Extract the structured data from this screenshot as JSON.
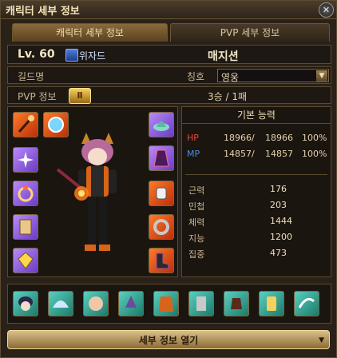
{
  "window": {
    "title": "캐릭터 세부 정보",
    "close_icon": "close-icon"
  },
  "tabs": [
    {
      "label": "캐릭터 세부 정보",
      "active": true
    },
    {
      "label": "PVP 세부 정보",
      "active": false
    }
  ],
  "info": {
    "level": "Lv. 60",
    "class_name": "위자드",
    "char_name": "매지션",
    "guild_label": "길드명",
    "guild_value": "",
    "title_label": "칭호",
    "title_value": "영웅",
    "pvp_label": "PVP 정보",
    "pvp_record": "3승  /  1패"
  },
  "stats": {
    "header": "기본 능력",
    "hp": {
      "label": "HP",
      "current": "18966/",
      "max": "18966",
      "pct": "100%",
      "color": "#e0483a"
    },
    "mp": {
      "label": "MP",
      "current": "14857/",
      "max": "14857",
      "pct": "100%",
      "color": "#4a8ce0"
    },
    "attrs": [
      {
        "label": "근력",
        "value": "176"
      },
      {
        "label": "민첩",
        "value": "203"
      },
      {
        "label": "체력",
        "value": "1444"
      },
      {
        "label": "지능",
        "value": "1200"
      },
      {
        "label": "집중",
        "value": "473"
      }
    ]
  },
  "equipment_left": [
    "staff-icon",
    "orb-icon",
    "sparkle-icon",
    "ring-icon",
    "scroll-icon",
    "gem-icon"
  ],
  "equipment_right": [
    "hat-icon",
    "robe-icon",
    "glove-icon",
    "bracelet-icon",
    "boot-icon"
  ],
  "cash_slots": [
    "hair-icon",
    "wing-icon",
    "face-icon",
    "hat-icon",
    "cloak-icon",
    "costume-icon",
    "glove-icon",
    "shoe-icon",
    "tail-icon"
  ],
  "footer": {
    "button_label": "세부 정보 열기"
  },
  "colors": {
    "accent": "#d9c08a",
    "panel": "#1b1510",
    "border": "#5a4a30"
  }
}
